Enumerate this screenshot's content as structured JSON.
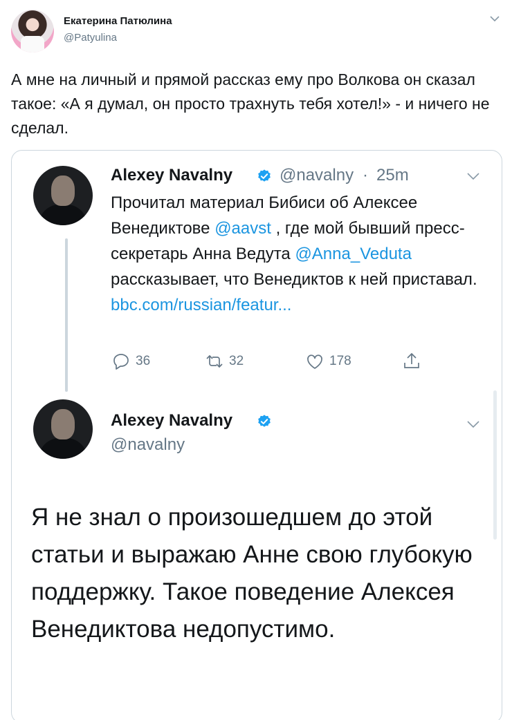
{
  "tweet": {
    "author_name": "Екатерина Патюлина",
    "author_handle": "@Patyulina",
    "text": "А мне на личный и прямой рассказ ему про Волкова он сказал такое: «А я думал, он просто трахнуть тебя хотел!» - и ничего не сделал."
  },
  "quoted": {
    "name": "Alexey Navalny",
    "handle": "@navalny",
    "separator": "·",
    "time": "25m",
    "text_parts": {
      "p1": "Прочитал материал Бибиси об Алексее Венедиктове ",
      "mention1": "@aavst",
      "p2": " , где мой бывший пресс-секретарь Анна Ведута ",
      "mention2": "@Anna_Veduta",
      "p3": " рассказывает, что Венедиктов к ней приставал.",
      "link": "bbc.com/russian/featur..."
    },
    "actions": {
      "replies": "36",
      "retweets": "32",
      "likes": "178"
    }
  },
  "reply": {
    "name": "Alexey Navalny",
    "handle": "@navalny",
    "text": "Я не знал о произошедшем до этой статьи и выражаю Анне свою глубокую поддержку. Такое поведение Алексея Венедиктова недопустимо."
  },
  "colors": {
    "link": "#1b95e0",
    "secondary": "#657786",
    "verified": "#1da1f2",
    "border": "#ccd6dd"
  },
  "icons": [
    "chevron-down-icon",
    "verified-badge-icon",
    "reply-icon",
    "retweet-icon",
    "like-icon",
    "share-icon"
  ]
}
